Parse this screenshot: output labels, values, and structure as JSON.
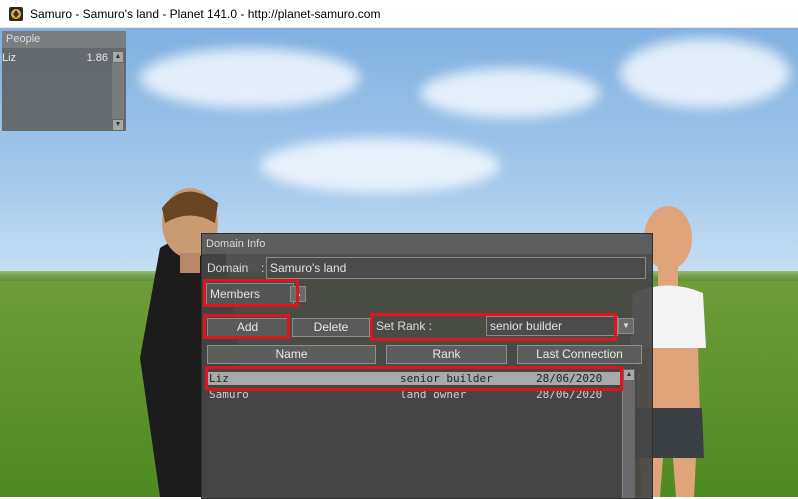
{
  "window": {
    "title": "Samuro - Samuro's land - Planet 141.0 - http://planet-samuro.com"
  },
  "people_panel": {
    "header": "People",
    "rows": [
      {
        "name": "Liz",
        "value": "1.86"
      }
    ]
  },
  "domain_info": {
    "title": "Domain Info",
    "domain_label": "Domain",
    "domain_separator": ":",
    "domain_value": "Samuro's land",
    "section_select": "Members",
    "add_label": "Add",
    "delete_label": "Delete",
    "set_rank_label": "Set Rank :",
    "rank_select": "senior builder",
    "columns": {
      "name": "Name",
      "rank": "Rank",
      "last_connection": "Last Connection"
    },
    "members": [
      {
        "name": "Liz",
        "rank": "senior builder",
        "last": "28/06/2020",
        "selected": true
      },
      {
        "name": "Samuro",
        "rank": "land owner",
        "last": "28/06/2020",
        "selected": false
      }
    ]
  },
  "colors": {
    "highlight": "#e0141e",
    "panel": "#464646",
    "selected_row": "#a9a9a9"
  },
  "icons": [
    "app-icon",
    "scroll-up-icon",
    "scroll-down-icon",
    "dropdown-arrow-icon"
  ]
}
